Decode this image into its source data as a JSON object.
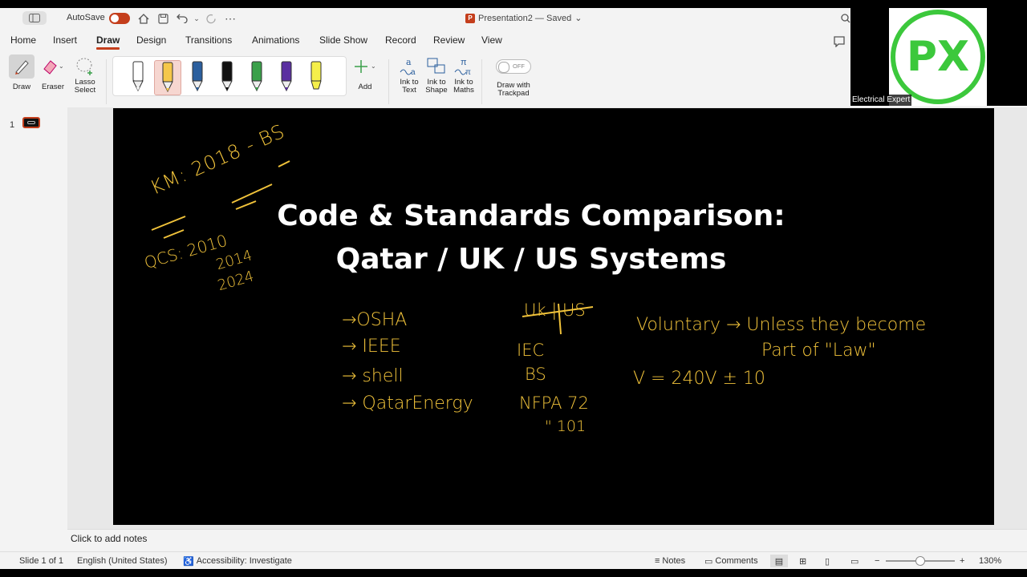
{
  "titlebar": {
    "autosave_label": "AutoSave",
    "doc_title": "Presentation2 — Saved",
    "doc_chevron": "⌄"
  },
  "tabs": [
    "Home",
    "Insert",
    "Draw",
    "Design",
    "Transitions",
    "Animations",
    "Slide Show",
    "Record",
    "Review",
    "View"
  ],
  "active_tab": "Draw",
  "ribbon": {
    "draw": "Draw",
    "eraser": "Eraser",
    "lasso_line1": "Lasso",
    "lasso_line2": "Select",
    "add": "Add",
    "ink_text_1": "Ink to",
    "ink_text_2": "Text",
    "ink_shape_1": "Ink to",
    "ink_shape_2": "Shape",
    "ink_maths_1": "Ink to",
    "ink_maths_2": "Maths",
    "trackpad_toggle": "OFF",
    "trackpad_1": "Draw with",
    "trackpad_2": "Trackpad",
    "pen_colors": [
      "#ffffff",
      "#f5c74a",
      "#2b5f9e",
      "#111111",
      "#3aa04a",
      "#5a2fa0",
      "#f5ef4a"
    ],
    "selected_pen": 1
  },
  "thumbnails": {
    "slide_number": "1"
  },
  "slide": {
    "title_line1": "Code & Standards Comparison:",
    "title_line2": "Qatar / UK / US Systems",
    "ink_color": "#f0c23a",
    "handwriting": {
      "km": "KM: 2018 - BS",
      "qcs": "QCS: 2010",
      "y2014": "2014",
      "y2024": "2024",
      "osha": "→OSHA",
      "ieee": "→ IEEE",
      "shell": "→ shell",
      "qe": "→ QatarEnergy",
      "ukus": "Uk | US",
      "iec": "IEC",
      "bs": "BS",
      "nfpa": "NFPA 72",
      "n101": "\" 101",
      "voluntary": "Voluntary → Unless they become",
      "partlaw": "Part of \"Law\"",
      "volt": "V = 240V ± 10"
    }
  },
  "notes_placeholder": "Click to add notes",
  "status": {
    "slide_of": "Slide 1 of 1",
    "language": "English (United States)",
    "accessibility": "Accessibility: Investigate",
    "notes": "Notes",
    "comments": "Comments",
    "zoom": "130%",
    "zoom_fraction": 0.5
  },
  "webcam": {
    "name": "Electrical Expert",
    "logo_text": "PX",
    "logo_color": "#3cc83c"
  }
}
